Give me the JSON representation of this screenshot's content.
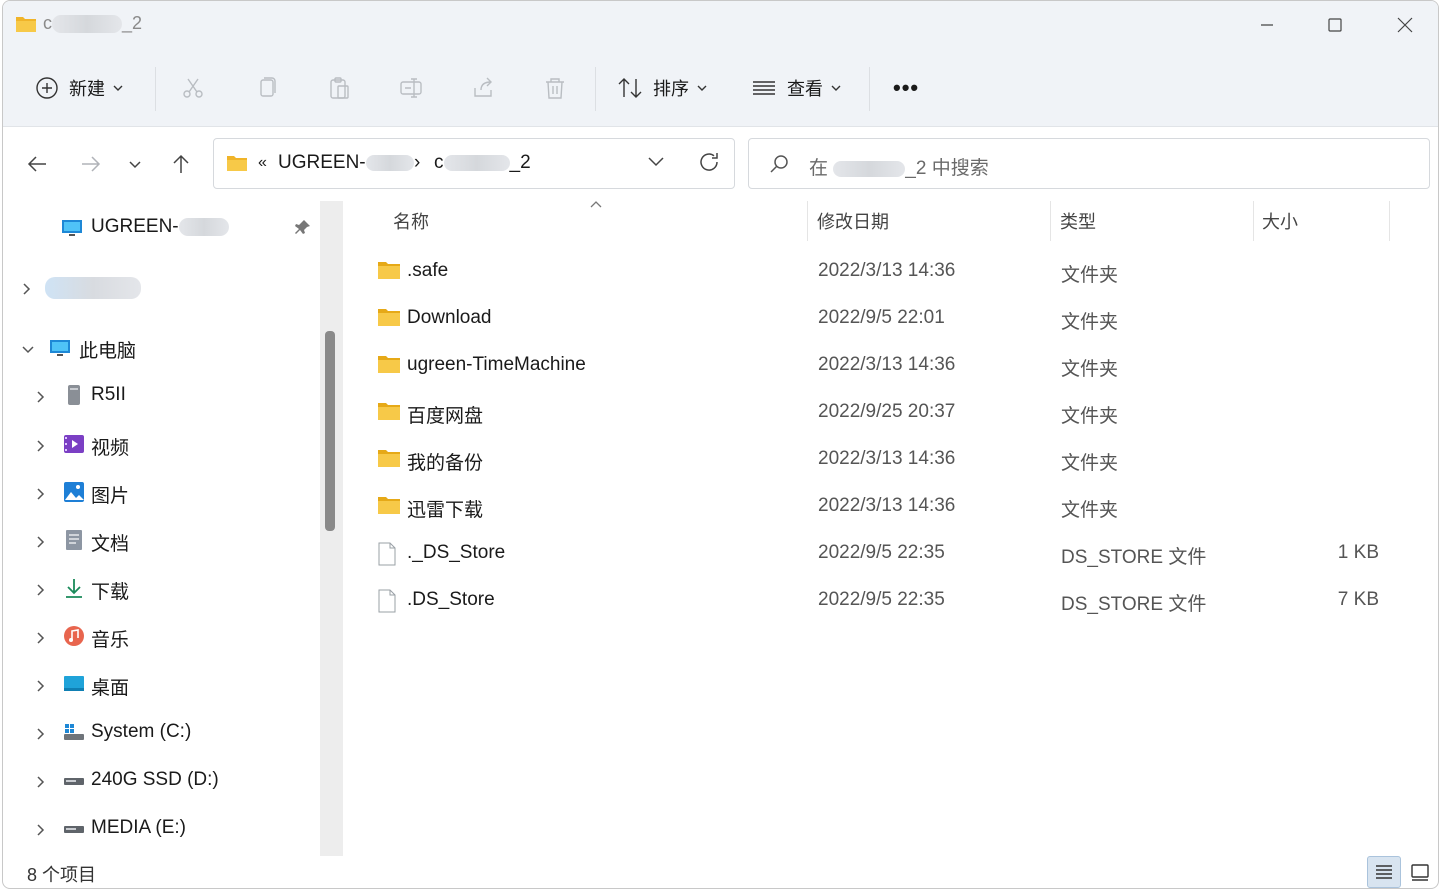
{
  "window": {
    "title_prefix": "c",
    "title_suffix": "_2"
  },
  "toolbar": {
    "new_label": "新建",
    "sort_label": "排序",
    "view_label": "查看",
    "more_label": "•••"
  },
  "address": {
    "overflow": "«",
    "crumb1_prefix": "UGREEN-",
    "sep": "›",
    "crumb2_prefix": "c",
    "crumb2_suffix": "_2"
  },
  "search": {
    "prefix": "在",
    "suffix": "_2 中搜索"
  },
  "sidebar": {
    "pinned_label": "UGREEN-",
    "items": [
      {
        "label": "此电脑",
        "icon": "monitor-icon"
      },
      {
        "label": "R5II",
        "icon": "nas-icon"
      },
      {
        "label": "视频",
        "icon": "video-icon"
      },
      {
        "label": "图片",
        "icon": "pictures-icon"
      },
      {
        "label": "文档",
        "icon": "documents-icon"
      },
      {
        "label": "下载",
        "icon": "download-icon"
      },
      {
        "label": "音乐",
        "icon": "music-icon"
      },
      {
        "label": "桌面",
        "icon": "desktop-icon"
      },
      {
        "label": "System (C:)",
        "icon": "system-drive-icon"
      },
      {
        "label": "240G SSD (D:)",
        "icon": "drive-icon"
      },
      {
        "label": "MEDIA (E:)",
        "icon": "drive-icon"
      }
    ]
  },
  "columns": {
    "name": "名称",
    "date": "修改日期",
    "type": "类型",
    "size": "大小"
  },
  "files": [
    {
      "name": ".safe",
      "date": "2022/3/13 14:36",
      "type": "文件夹",
      "size": "",
      "kind": "folder"
    },
    {
      "name": "Download",
      "date": "2022/9/5 22:01",
      "type": "文件夹",
      "size": "",
      "kind": "folder"
    },
    {
      "name": "ugreen-TimeMachine",
      "date": "2022/3/13 14:36",
      "type": "文件夹",
      "size": "",
      "kind": "folder"
    },
    {
      "name": "百度网盘",
      "date": "2022/9/25 20:37",
      "type": "文件夹",
      "size": "",
      "kind": "folder"
    },
    {
      "name": "我的备份",
      "date": "2022/3/13 14:36",
      "type": "文件夹",
      "size": "",
      "kind": "folder"
    },
    {
      "name": "迅雷下载",
      "date": "2022/3/13 14:36",
      "type": "文件夹",
      "size": "",
      "kind": "folder"
    },
    {
      "name": "._DS_Store",
      "date": "2022/9/5 22:35",
      "type": "DS_STORE 文件",
      "size": "1 KB",
      "kind": "file"
    },
    {
      "name": ".DS_Store",
      "date": "2022/9/5 22:35",
      "type": "DS_STORE 文件",
      "size": "7 KB",
      "kind": "file"
    }
  ],
  "status": {
    "count": "8 个项目"
  },
  "colors": {
    "folder": "#f7c948",
    "folder_dark": "#e6a917",
    "accent": "#0067c0"
  }
}
